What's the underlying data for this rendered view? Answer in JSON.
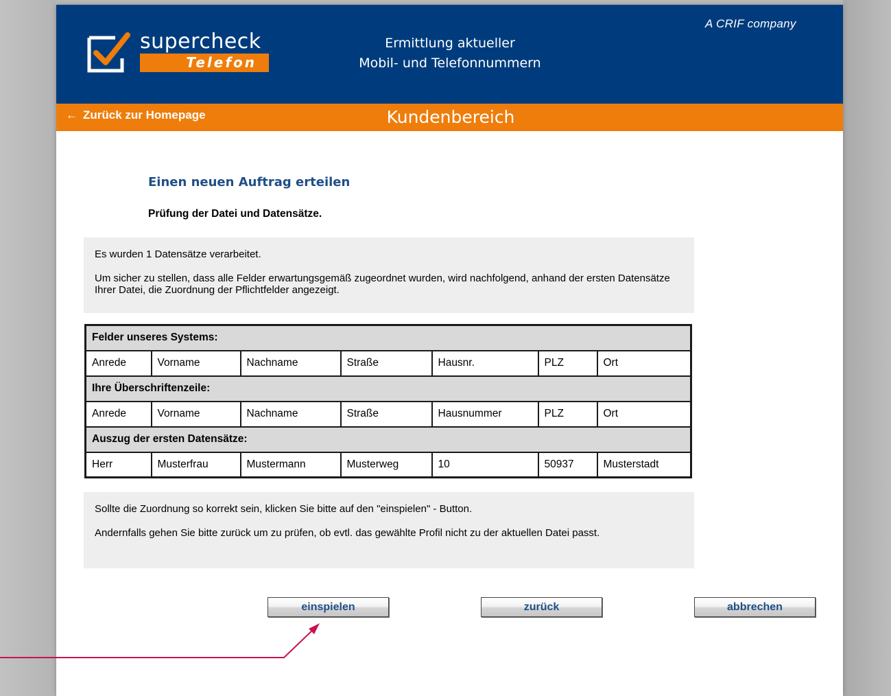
{
  "header": {
    "logo_word": "supercheck",
    "logo_sub": "Telefon",
    "tagline_line1": "Ermittlung aktueller",
    "tagline_line2": "Mobil- und Telefonnummern",
    "company": "A CRIF company",
    "brand_blue": "#003c7d",
    "brand_orange": "#ef7d0b"
  },
  "nav": {
    "back_label": "Zurück zur Homepage",
    "back_icon": "left-arrow-icon",
    "section_title": "Kundenbereich"
  },
  "main": {
    "title": "Einen neuen Auftrag erteilen",
    "subtitle": "Prüfung der Datei und Datensätze.",
    "info1_line1": "Es wurden 1 Datensätze verarbeitet.",
    "info1_line2": "Um sicher zu stellen, dass alle Felder erwartungsgemäß zugeordnet wurden, wird nachfolgend, anhand der ersten Datensätze Ihrer Datei, die Zuordnung der Pflichtfelder angezeigt.",
    "info2_line1": "Sollte die Zuordnung so korrekt sein, klicken Sie bitte auf den \"einspielen\" - Button.",
    "info2_line2": "Andernfalls gehen Sie bitte zurück um zu prüfen, ob evtl. das gewählte Profil nicht zu der aktuellen Datei passt."
  },
  "table": {
    "sections": [
      {
        "heading": "Felder unseres Systems:",
        "cells": [
          "Anrede",
          "Vorname",
          "Nachname",
          "Straße",
          "Hausnr.",
          "PLZ",
          "Ort"
        ]
      },
      {
        "heading": "Ihre Überschriftenzeile:",
        "cells": [
          "Anrede",
          "Vorname",
          "Nachname",
          "Straße",
          "Hausnummer",
          "PLZ",
          "Ort"
        ]
      },
      {
        "heading": "Auszug der ersten Datensätze:",
        "cells": [
          "Herr",
          "Musterfrau",
          "Mustermann",
          "Musterweg",
          "10",
          "50937",
          "Musterstadt"
        ]
      }
    ]
  },
  "buttons": {
    "submit": "einspielen",
    "back": "zurück",
    "cancel": "abbrechen"
  }
}
